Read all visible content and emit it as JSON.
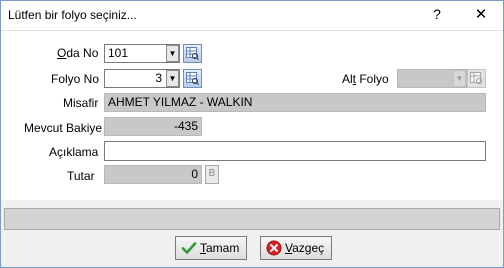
{
  "window": {
    "title": "Lütfen bir folyo seçiniz...",
    "help": "?",
    "close": "✕"
  },
  "form": {
    "oda_no": {
      "label_prefix": "O",
      "label_rest": "da No",
      "value": "101"
    },
    "folyo_no": {
      "label": "Folyo No",
      "value": "3"
    },
    "alt_folyo": {
      "label_prefix": "Al",
      "label_underlined": "t",
      "label_rest": " Folyo",
      "value": ""
    },
    "misafir": {
      "label": "Misafir",
      "value": "AHMET YILMAZ - WALKIN"
    },
    "mevcut_bakiye": {
      "label": "Mevcut Bakiye",
      "value": "-435"
    },
    "aciklama": {
      "label": "Açıklama",
      "value": ""
    },
    "tutar": {
      "label": "Tutar",
      "value": "0",
      "button": "B"
    }
  },
  "status": {
    "text": ""
  },
  "buttons": {
    "ok": {
      "underlined": "T",
      "rest": "amam"
    },
    "cancel": {
      "underlined": "V",
      "rest": "azgeç"
    }
  },
  "icons": {
    "dropdown": "dropdown-arrow-icon",
    "search": "grid-search-icon",
    "ok": "checkmark-icon",
    "cancel": "cancel-icon"
  },
  "colors": {
    "readonly_bg": "#c8c8c8",
    "ok_green": "#2e9b2e",
    "cancel_red": "#d42020"
  }
}
